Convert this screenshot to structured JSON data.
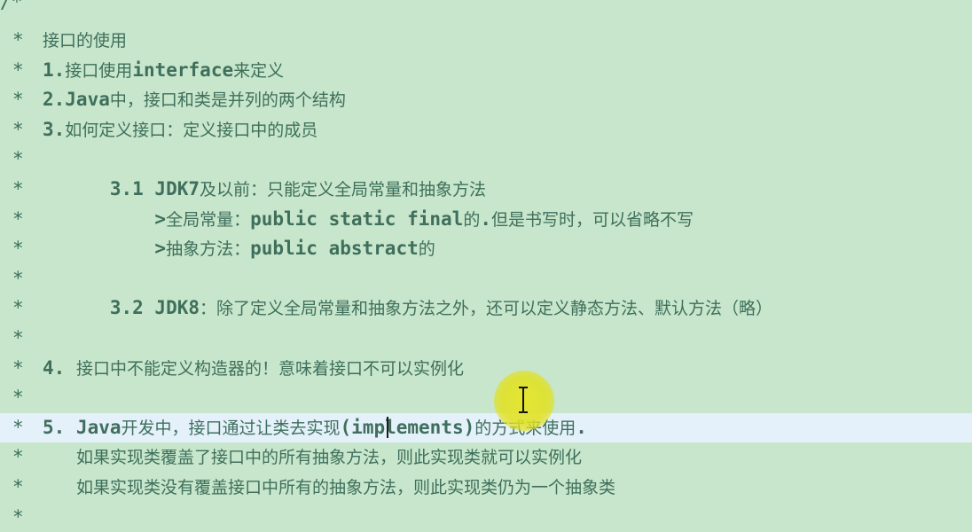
{
  "editor": {
    "first_line": "/*",
    "lines": [
      {
        "star": "*",
        "segments": [
          {
            "text": "接口的使用",
            "cjk": true
          }
        ]
      },
      {
        "star": "*",
        "segments": [
          {
            "text": "1.",
            "cjk": false
          },
          {
            "text": "接口使用",
            "cjk": true
          },
          {
            "text": "interface",
            "cjk": false
          },
          {
            "text": "来定义",
            "cjk": true
          }
        ]
      },
      {
        "star": "*",
        "segments": [
          {
            "text": "2.Java",
            "cjk": false
          },
          {
            "text": "中，接口和类是并列的两个结构",
            "cjk": true
          }
        ]
      },
      {
        "star": "*",
        "segments": [
          {
            "text": "3.",
            "cjk": false
          },
          {
            "text": "如何定义接口：定义接口中的成员",
            "cjk": true
          }
        ]
      },
      {
        "star": "*",
        "segments": []
      },
      {
        "star": "*",
        "segments": [
          {
            "text": "      3.1 JDK7",
            "cjk": false
          },
          {
            "text": "及以前：只能定义全局常量和抽象方法",
            "cjk": true
          }
        ]
      },
      {
        "star": "*",
        "segments": [
          {
            "text": "          >",
            "cjk": false
          },
          {
            "text": "全局常量：",
            "cjk": true
          },
          {
            "text": "public static final",
            "cjk": false
          },
          {
            "text": "的",
            "cjk": true
          },
          {
            "text": ".",
            "cjk": false
          },
          {
            "text": "但是书写时，可以省略不写",
            "cjk": true
          }
        ]
      },
      {
        "star": "*",
        "segments": [
          {
            "text": "          >",
            "cjk": false
          },
          {
            "text": "抽象方法：",
            "cjk": true
          },
          {
            "text": "public abstract",
            "cjk": false
          },
          {
            "text": "的",
            "cjk": true
          }
        ]
      },
      {
        "star": "*",
        "segments": []
      },
      {
        "star": "*",
        "segments": [
          {
            "text": "      3.2 JDK8",
            "cjk": false
          },
          {
            "text": "：除了定义全局常量和抽象方法之外，还可以定义静态方法、默认方法（略）",
            "cjk": true
          }
        ]
      },
      {
        "star": "*",
        "segments": []
      },
      {
        "star": "*",
        "segments": [
          {
            "text": "4. ",
            "cjk": false
          },
          {
            "text": "接口中不能定义构造器的！意味着接口不可以实例化",
            "cjk": true
          }
        ]
      },
      {
        "star": "*",
        "segments": []
      },
      {
        "star": "*",
        "segments": [
          {
            "text": "5. Java",
            "cjk": false
          },
          {
            "text": "开发中，接口通过让类去实现",
            "cjk": true
          },
          {
            "text": "(implements)",
            "cjk": false
          },
          {
            "text": "的方式来使用",
            "cjk": true
          },
          {
            "text": ".",
            "cjk": false
          }
        ]
      },
      {
        "star": "*",
        "segments": [
          {
            "text": "   ",
            "cjk": false
          },
          {
            "text": "如果实现类覆盖了接口中的所有抽象方法，则此实现类就可以实例化",
            "cjk": true
          }
        ]
      },
      {
        "star": "*",
        "segments": [
          {
            "text": "   ",
            "cjk": false
          },
          {
            "text": "如果实现类没有覆盖接口中所有的抽象方法，则此实现类仍为一个抽象类",
            "cjk": true
          }
        ]
      },
      {
        "star": "*",
        "segments": []
      }
    ],
    "highlighted_line_index": 13
  },
  "colors": {
    "background": "#c7e6cb",
    "comment_text": "#3f6f5c",
    "current_line_highlight": "#e4f1fa",
    "cursor_highlight": "#e6e628"
  },
  "icons": {
    "mouse_cursor": "i-beam-cursor-icon"
  }
}
